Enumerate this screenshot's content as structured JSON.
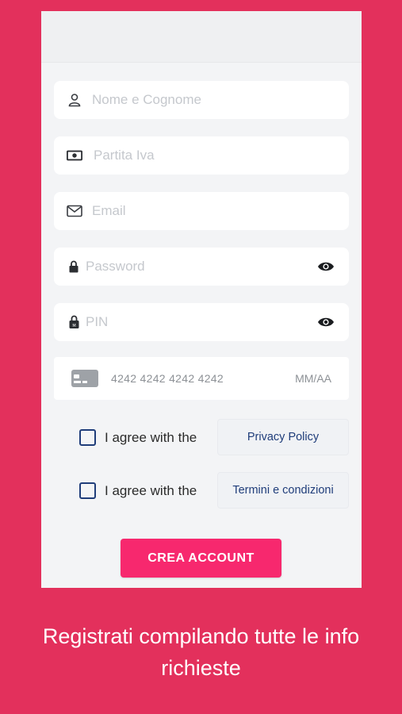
{
  "form": {
    "name_placeholder": "Nome e Cognome",
    "vat_placeholder": "Partita Iva",
    "email_placeholder": "Email",
    "password_placeholder": "Password",
    "pin_placeholder": "PIN",
    "card_number_placeholder": "4242 4242 4242 4242",
    "card_expiry_placeholder": "MM/AA"
  },
  "consents": [
    {
      "text": "I agree with the",
      "link": "Privacy Policy"
    },
    {
      "text": "I agree with the",
      "link": "Termini e condizioni"
    }
  ],
  "cta_label": "CREA ACCOUNT",
  "caption": "Registrati compilando tutte le info richieste",
  "colors": {
    "background": "#e3305c",
    "button": "#f7286e",
    "link": "#1f3d7a"
  }
}
